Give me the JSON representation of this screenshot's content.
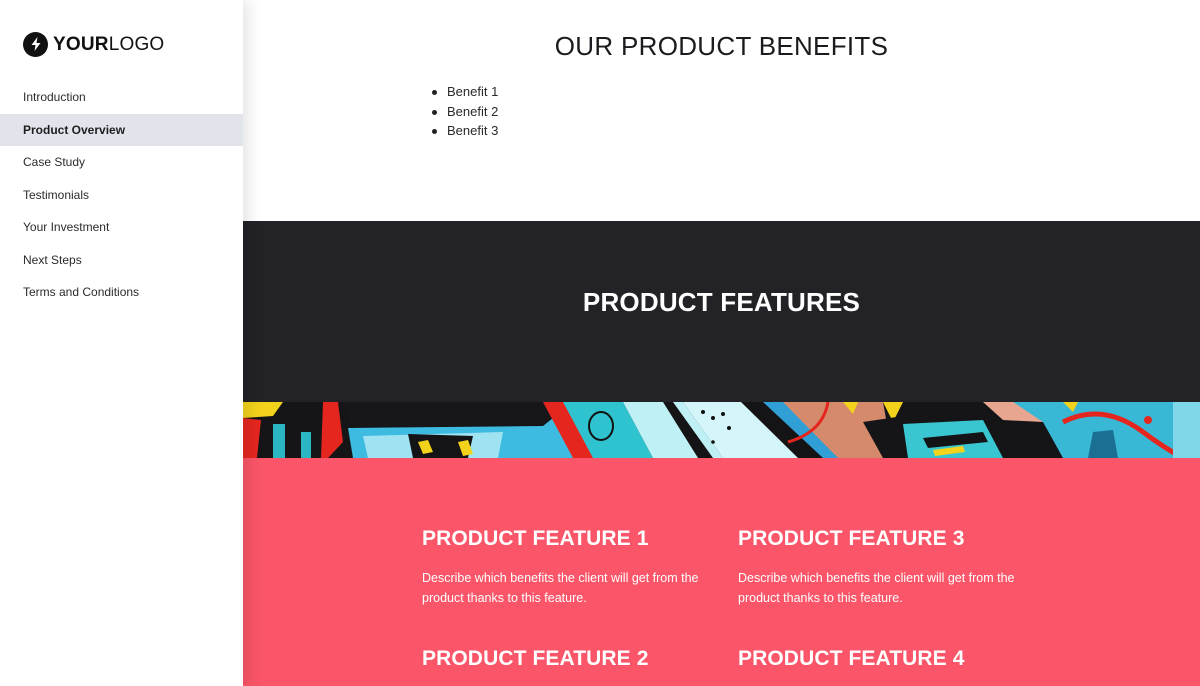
{
  "brand": {
    "logo_icon": "lightning-bolt-icon",
    "logo_bold": "YOUR",
    "logo_light": "LOGO"
  },
  "sidebar": {
    "items": [
      {
        "label": "Introduction",
        "active": false
      },
      {
        "label": "Product Overview",
        "active": true
      },
      {
        "label": "Case Study",
        "active": false
      },
      {
        "label": "Testimonials",
        "active": false
      },
      {
        "label": "Your Investment",
        "active": false
      },
      {
        "label": "Next Steps",
        "active": false
      },
      {
        "label": "Terms and Conditions",
        "active": false
      }
    ]
  },
  "benefits": {
    "title": "OUR PRODUCT BENEFITS",
    "items": [
      "Benefit 1",
      "Benefit 2",
      "Benefit 3"
    ]
  },
  "features_section": {
    "title": "PRODUCT FEATURES",
    "banner_image": "graffiti-art-banner"
  },
  "features": [
    {
      "title": "PRODUCT FEATURE 1",
      "description": "Describe which benefits the client will get from the product thanks to this feature."
    },
    {
      "title": "PRODUCT FEATURE 2",
      "description": ""
    },
    {
      "title": "PRODUCT FEATURE 3",
      "description": "Describe which benefits the client will get from the product thanks to this feature."
    },
    {
      "title": "PRODUCT FEATURE 4",
      "description": ""
    }
  ],
  "colors": {
    "sidebar_active_bg": "#e1e4ea",
    "dark_band": "#232227",
    "accent_pink": "#fa5568",
    "text_dark": "#1b1b1f"
  }
}
